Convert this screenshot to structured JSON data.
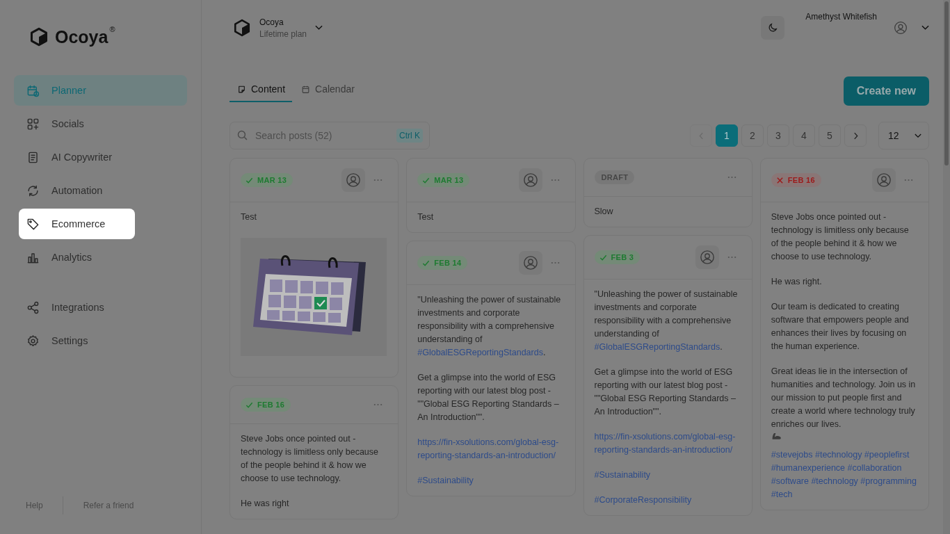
{
  "brand": {
    "name": "Ocoya",
    "mark": "®"
  },
  "nav": [
    {
      "label": "Planner",
      "selected": true,
      "highlighted": false
    },
    {
      "label": "Socials",
      "selected": false,
      "highlighted": false
    },
    {
      "label": "AI Copywriter",
      "selected": false,
      "highlighted": false
    },
    {
      "label": "Automation",
      "selected": false,
      "highlighted": false
    },
    {
      "label": "Ecommerce",
      "selected": false,
      "highlighted": true
    },
    {
      "label": "Analytics",
      "selected": false,
      "highlighted": false
    }
  ],
  "nav_secondary": [
    {
      "label": "Integrations",
      "selected": false,
      "highlighted": false
    },
    {
      "label": "Settings",
      "selected": false,
      "highlighted": false
    }
  ],
  "footer_links": [
    "Help",
    "Refer a friend"
  ],
  "workspace": {
    "name": "Ocoya",
    "plan": "Lifetime plan"
  },
  "user": {
    "name": "Amethyst Whitefish"
  },
  "tabs": [
    {
      "label": "Content",
      "selected": true
    },
    {
      "label": "Calendar",
      "selected": false
    }
  ],
  "create_button": "Create new",
  "search": {
    "placeholder": "Search posts (52)",
    "shortcut": "Ctrl K"
  },
  "pagination": {
    "pages": [
      {
        "label": "1",
        "selected": true
      },
      {
        "label": "2",
        "selected": false
      },
      {
        "label": "3",
        "selected": false
      },
      {
        "label": "4",
        "selected": false
      },
      {
        "label": "5",
        "selected": false
      }
    ],
    "page_size": "12"
  },
  "columns": [
    {
      "cards": [
        {
          "status": {
            "kind": "published",
            "label": "MAR 13"
          },
          "show_avatar": true,
          "has_image": true,
          "paragraphs": [
            [
              {
                "text": "Test",
                "link": false
              }
            ]
          ]
        },
        {
          "status": {
            "kind": "published",
            "label": "FEB 16"
          },
          "show_avatar": false,
          "has_image": false,
          "paragraphs": [
            [
              {
                "text": "Steve Jobs once pointed out - technology is limitless only because of the people behind it & how we choose to use technology.",
                "link": false
              }
            ],
            [
              {
                "text": "He was right",
                "link": false
              }
            ]
          ]
        }
      ]
    },
    {
      "cards": [
        {
          "status": {
            "kind": "published",
            "label": "MAR 13"
          },
          "show_avatar": true,
          "has_image": false,
          "paragraphs": [
            [
              {
                "text": "Test",
                "link": false
              }
            ]
          ]
        },
        {
          "status": {
            "kind": "published",
            "label": "FEB 14"
          },
          "show_avatar": true,
          "has_image": false,
          "paragraphs": [
            [
              {
                "text": "\"Unleashing the power of sustainable investments and corporate responsibility with a comprehensive understanding of ",
                "link": false
              },
              {
                "text": "#GlobalESGReportingStandards",
                "link": true
              },
              {
                "text": ".",
                "link": false
              }
            ],
            [
              {
                "text": "Get a glimpse into the world of ESG reporting with our latest blog post - \"\"Global ESG Reporting Standards – An Introduction\"\".",
                "link": false
              }
            ],
            [
              {
                "text": "https://fin-xsolutions.com/global-esg-reporting-standards-an-introduction/",
                "link": true
              }
            ],
            [
              {
                "text": "#Sustainability",
                "link": true
              }
            ]
          ]
        }
      ]
    },
    {
      "cards": [
        {
          "status": {
            "kind": "draft",
            "label": "DRAFT"
          },
          "show_avatar": false,
          "has_image": false,
          "paragraphs": [
            [
              {
                "text": "Slow",
                "link": false
              }
            ]
          ]
        },
        {
          "status": {
            "kind": "published",
            "label": "FEB 3"
          },
          "show_avatar": true,
          "has_image": false,
          "paragraphs": [
            [
              {
                "text": "\"Unleashing the power of sustainable investments and corporate responsibility with a comprehensive understanding of ",
                "link": false
              },
              {
                "text": "#GlobalESGReportingStandards",
                "link": true
              },
              {
                "text": ".",
                "link": false
              }
            ],
            [
              {
                "text": "Get a glimpse into the world of ESG reporting with our latest blog post - \"\"Global ESG Reporting Standards – An Introduction\"\".",
                "link": false
              }
            ],
            [
              {
                "text": "https://fin-xsolutions.com/global-esg-reporting-standards-an-introduction/",
                "link": true
              }
            ],
            [
              {
                "text": "#Sustainability",
                "link": true
              }
            ],
            [
              {
                "text": "#CorporateResponsibility",
                "link": true
              }
            ]
          ]
        }
      ]
    },
    {
      "cards": [
        {
          "status": {
            "kind": "failed",
            "label": "FEB 16"
          },
          "show_avatar": true,
          "has_image": false,
          "paragraphs": [
            [
              {
                "text": "Steve Jobs once pointed out - technology is limitless only because of the people behind it & how we choose to use technology.",
                "link": false
              }
            ],
            [
              {
                "text": "He was right.",
                "link": false
              }
            ],
            [
              {
                "text": "Our team is dedicated to creating software that empowers people and enhances their lives by focusing on the human experience.",
                "link": false
              }
            ],
            [
              {
                "text": "Great ideas lie in the intersection of humanities and technology. Join us in our mission to put people first and create a world where technology truly enriches our lives.",
                "link": false
              }
            ],
            [
              {
                "text": "#stevejobs #technology #peoplefirst #humanexperience #collaboration #software #technology #programming #tech",
                "link": true
              }
            ]
          ]
        }
      ]
    }
  ]
}
